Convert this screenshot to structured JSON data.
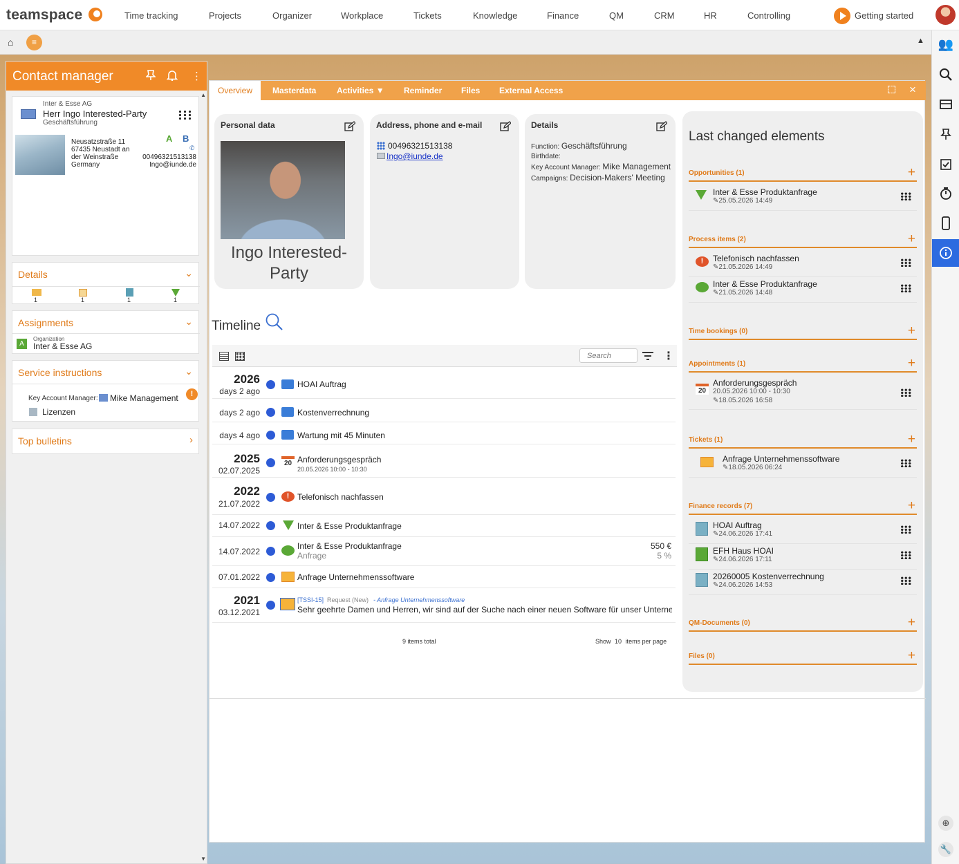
{
  "app": {
    "logo": "teamspace",
    "getting_started": "Getting started"
  },
  "nav": [
    "Time tracking",
    "Projects",
    "Organizer",
    "Workplace",
    "Tickets",
    "Knowledge",
    "Finance",
    "QM",
    "CRM",
    "HR",
    "Controlling"
  ],
  "contact_manager": {
    "title": "Contact manager",
    "company": "Inter & Esse AG",
    "name": "Herr Ingo Interested-Party",
    "role": "Geschäftsführung",
    "street": "Neusatzstraße 11",
    "city_line1": "67435 Neustadt an",
    "city_line2": "der Weinstraße",
    "country": "Germany",
    "phone": "00496321513138",
    "email": "Ingo@iunde.de",
    "details_title": "Details",
    "details_counts": [
      "1",
      "1",
      "1",
      "1"
    ],
    "assignments_title": "Assignments",
    "org_label": "Organization",
    "org_name": "Inter & Esse AG",
    "service_title": "Service instructions",
    "kam_label": "Key Account Manager:",
    "kam_name": "Mike Management",
    "licenses": "Lizenzen",
    "bulletins_title": "Top bulletins"
  },
  "tabs": [
    "Overview",
    "Masterdata",
    "Activities ▼",
    "Reminder",
    "Files",
    "External Access"
  ],
  "personal": {
    "title": "Personal data",
    "name_line1": "Ingo Interested-",
    "name_line2": "Party"
  },
  "address": {
    "title": "Address, phone and e-mail",
    "phone": "00496321513138",
    "email": "Ingo@iunde.de"
  },
  "details": {
    "title": "Details",
    "function_label": "Function:",
    "function_value": "Geschäftsführung",
    "birthdate_label": "Birthdate:",
    "kam_label": "Key Account Manager:",
    "kam_value": "Mike Management",
    "campaigns_label": "Campaigns:",
    "campaigns_value": "Decision-Makers' Meeting"
  },
  "timeline": {
    "title": "Timeline",
    "search_placeholder": "Search",
    "rows": [
      {
        "year": "2026",
        "date": "days 2 ago",
        "text": "HOAI Auftrag",
        "sub": ""
      },
      {
        "year": "",
        "date": "days 2 ago",
        "text": "Kostenverrechnung",
        "sub": ""
      },
      {
        "year": "",
        "date": "days 4 ago",
        "text": "Wartung mit 45 Minuten",
        "sub": ""
      },
      {
        "year": "2025",
        "date": "02.07.2025",
        "text": "Anforderungsgespräch",
        "sub": "20.05.2026 10:00 - 10:30"
      },
      {
        "year": "2022",
        "date": "21.07.2022",
        "text": "Telefonisch nachfassen",
        "sub": ""
      },
      {
        "year": "",
        "date": "14.07.2022",
        "text": "Inter & Esse Produktanfrage",
        "sub": ""
      },
      {
        "year": "",
        "date": "14.07.2022",
        "text": "Inter & Esse Produktanfrage",
        "sub": "Anfrage",
        "amount": "550 €",
        "percent": "5 %"
      },
      {
        "year": "",
        "date": "07.01.2022",
        "text": "Anfrage Unternehmenssoftware",
        "sub": ""
      },
      {
        "year": "2021",
        "date": "03.12.2021",
        "text": "Sehr geehrte Damen und Herren, wir sind auf der Suche nach einer neuen Software für unser Unterneh...",
        "sub": ""
      }
    ],
    "ticket_id": "[TSSI-15]",
    "ticket_status": "Request (New)",
    "ticket_link": "- Anfrage Unternehmenssoftware",
    "total": "9 items total",
    "show": "Show",
    "per_page_value": "10",
    "per_page": "items per page"
  },
  "lce": {
    "title": "Last changed elements",
    "sections": {
      "opportunities": "Opportunities (1)",
      "process": "Process items (2)",
      "time": "Time bookings (0)",
      "appointments": "Appointments (1)",
      "tickets": "Tickets (1)",
      "finance": "Finance records (7)",
      "qm": "QM-Documents (0)",
      "files": "Files (0)"
    },
    "items": {
      "opp1": {
        "name": "Inter & Esse Produktanfrage",
        "date": "25.05.2026 14:49"
      },
      "proc1": {
        "name": "Telefonisch nachfassen",
        "date": "21.05.2026 14:49"
      },
      "proc2": {
        "name": "Inter & Esse Produktanfrage",
        "date": "21.05.2026 14:48"
      },
      "app1": {
        "name": "Anforderungsgespräch",
        "time": "20.05.2026 10:00 - 10:30",
        "date": "18.05.2026 16:58",
        "day": "20"
      },
      "tick1": {
        "name": "Anfrage Unternehmenssoftware",
        "date": "18.05.2026 06:24"
      },
      "fin1": {
        "name": "HOAI Auftrag",
        "date": "24.06.2026 17:41"
      },
      "fin2": {
        "name": "EFH Haus HOAI",
        "date": "24.06.2026 17:11"
      },
      "fin3": {
        "name": "20260005 Kostenverrechnung",
        "date": "24.06.2026 14:53"
      }
    }
  }
}
